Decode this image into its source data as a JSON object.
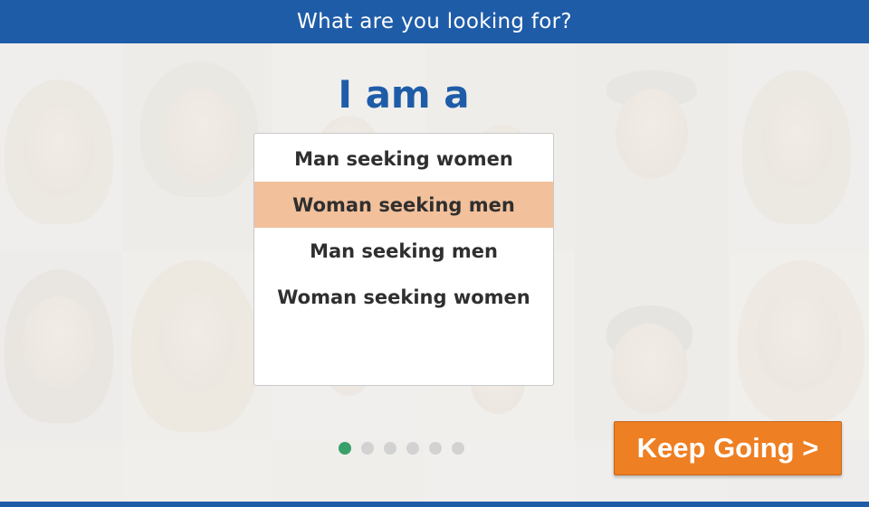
{
  "header": {
    "title": "What are you looking for?"
  },
  "main": {
    "heading": "I am a",
    "options": [
      {
        "label": "Man seeking women",
        "selected": false
      },
      {
        "label": "Woman seeking men",
        "selected": true
      },
      {
        "label": "Man seeking men",
        "selected": false
      },
      {
        "label": "Woman seeking women",
        "selected": false
      }
    ],
    "pagination": {
      "total_steps": 6,
      "current_step": 1
    },
    "next_button": {
      "label": "Keep Going >"
    }
  },
  "colors": {
    "brand_blue": "#1f5ca8",
    "accent_orange": "#ee7f22",
    "selected_option": "#f2c09a",
    "active_dot": "#3aa06a"
  }
}
